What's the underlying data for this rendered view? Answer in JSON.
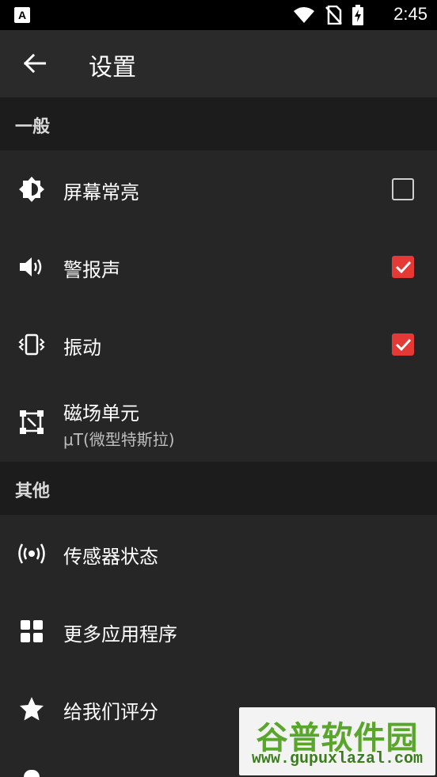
{
  "statusbar": {
    "app_badge": "A",
    "time": "2:45"
  },
  "appbar": {
    "title": "设置"
  },
  "sections": {
    "general": "一般",
    "other": "其他"
  },
  "general_items": {
    "screen_on": {
      "label": "屏幕常亮",
      "checked": false
    },
    "alarm_sound": {
      "label": "警报声",
      "checked": true
    },
    "vibration": {
      "label": "振动",
      "checked": true
    },
    "magnetic_unit": {
      "label": "磁场单元",
      "value": "μT(微型特斯拉)"
    }
  },
  "other_items": {
    "sensor_status": {
      "label": "传感器状态"
    },
    "more_apps": {
      "label": "更多应用程序"
    },
    "rate_us": {
      "label": "给我们评分"
    }
  },
  "watermark": {
    "title": "谷普软件园",
    "url": "www.gupuxlazal.com"
  },
  "colors": {
    "accent": "#e53935",
    "background": "#262626",
    "section": "#1c1c1c",
    "appbar": "#2a2a2a"
  },
  "icons": {
    "back": "arrow-left-icon",
    "screen_on": "brightness-icon",
    "alarm_sound": "volume-icon",
    "vibration": "vibrate-icon",
    "magnetic_unit": "select-frame-icon",
    "sensor_status": "broadcast-icon",
    "more_apps": "grid-icon",
    "rate_us": "star-icon"
  }
}
